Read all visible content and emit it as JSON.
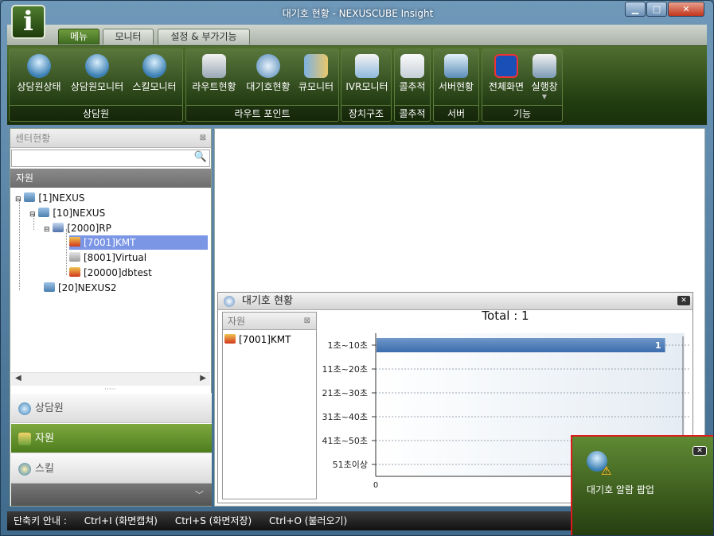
{
  "window": {
    "title": "대기호 현황 - NEXUSCUBE Insight",
    "logo_letter": "i"
  },
  "tabs": [
    {
      "label": "메뉴"
    },
    {
      "label": "모니터"
    },
    {
      "label": "설정 & 부가기능"
    }
  ],
  "ribbon": {
    "groups": [
      {
        "label": "상담원",
        "buttons": [
          {
            "label": "상담원상태",
            "icon": "agent-status-icon"
          },
          {
            "label": "상담원모니터",
            "icon": "agent-monitor-icon"
          },
          {
            "label": "스킬모니터",
            "icon": "skill-monitor-icon"
          }
        ]
      },
      {
        "label": "라우트 포인트",
        "buttons": [
          {
            "label": "라우트현황",
            "icon": "route-status-icon"
          },
          {
            "label": "대기호현황",
            "icon": "waiting-call-icon"
          },
          {
            "label": "큐모니터",
            "icon": "queue-monitor-icon"
          }
        ]
      },
      {
        "label": "장치구조",
        "buttons": [
          {
            "label": "IVR모니터",
            "icon": "ivr-monitor-icon"
          }
        ]
      },
      {
        "label": "콜추적",
        "buttons": [
          {
            "label": "콜추적",
            "icon": "call-trace-icon"
          }
        ]
      },
      {
        "label": "서버",
        "buttons": [
          {
            "label": "서버현황",
            "icon": "server-status-icon"
          }
        ]
      },
      {
        "label": "기능",
        "buttons": [
          {
            "label": "전체화면",
            "icon": "fullscreen-icon"
          },
          {
            "label": "실행창",
            "icon": "run-window-icon"
          }
        ]
      }
    ]
  },
  "left_panel": {
    "header": "센터현황",
    "resource_label": "자원",
    "tree": [
      {
        "label": "[1]NEXUS"
      },
      {
        "label": "[10]NEXUS"
      },
      {
        "label": "[2000]RP"
      },
      {
        "label": "[7001]KMT"
      },
      {
        "label": "[8001]Virtual"
      },
      {
        "label": "[20000]dbtest"
      },
      {
        "label": "[20]NEXUS2"
      }
    ],
    "nav": [
      {
        "label": "상담원"
      },
      {
        "label": "자원"
      },
      {
        "label": "스킬"
      }
    ]
  },
  "waiting_panel": {
    "title": "대기호 현황",
    "resource_header": "자원",
    "resource_item": "[7001]KMT",
    "total_label": "Total  :  1"
  },
  "chart_data": {
    "type": "bar",
    "orientation": "horizontal",
    "categories": [
      "1초~10초",
      "11초~20초",
      "21초~30초",
      "31초~40초",
      "41초~50초",
      "51초이상"
    ],
    "values": [
      1,
      0,
      0,
      0,
      0,
      0
    ],
    "data_labels": [
      "1",
      "",
      "",
      "",
      "",
      ""
    ],
    "x_ticks": [
      "0"
    ],
    "xlim": [
      0,
      1.07
    ],
    "grid": true,
    "title": "Total  :  1",
    "colors": {
      "bar": "#3c6cac",
      "plot_bg": "#e5ecf3"
    }
  },
  "popup": {
    "text": "대기호 알람 팝업"
  },
  "status_bar": {
    "items": [
      "단축키 안내   :",
      "Ctrl+I (화면캡쳐)",
      "Ctrl+S (화면저장)",
      "Ctrl+O (불러오기)"
    ]
  }
}
